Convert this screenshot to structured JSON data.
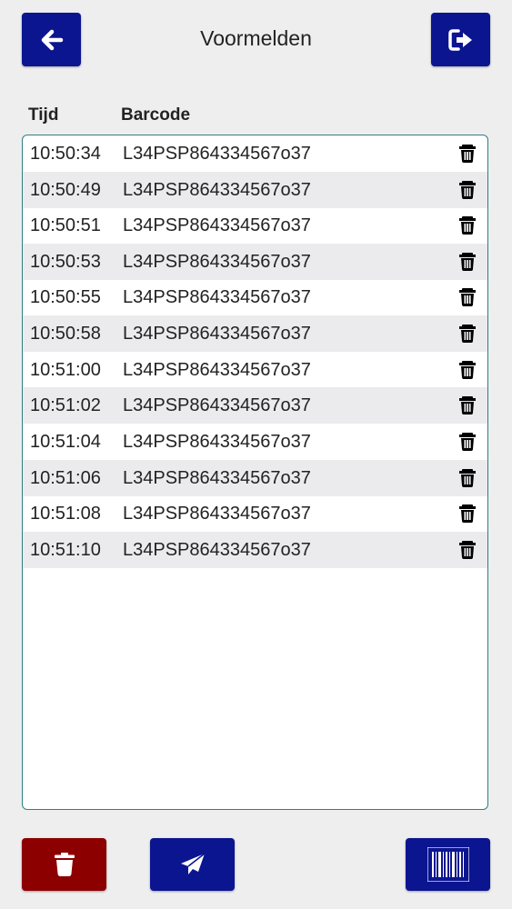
{
  "header": {
    "title": "Voormelden",
    "back_icon": "arrow-left-icon",
    "logout_icon": "sign-out-icon"
  },
  "columns": {
    "time": "Tijd",
    "barcode": "Barcode"
  },
  "rows": [
    {
      "time": "10:50:34",
      "barcode": "L34PSP864334567o37"
    },
    {
      "time": "10:50:49",
      "barcode": "L34PSP864334567o37"
    },
    {
      "time": "10:50:51",
      "barcode": "L34PSP864334567o37"
    },
    {
      "time": "10:50:53",
      "barcode": "L34PSP864334567o37"
    },
    {
      "time": "10:50:55",
      "barcode": "L34PSP864334567o37"
    },
    {
      "time": "10:50:58",
      "barcode": "L34PSP864334567o37"
    },
    {
      "time": "10:51:00",
      "barcode": "L34PSP864334567o37"
    },
    {
      "time": "10:51:02",
      "barcode": "L34PSP864334567o37"
    },
    {
      "time": "10:51:04",
      "barcode": "L34PSP864334567o37"
    },
    {
      "time": "10:51:06",
      "barcode": "L34PSP864334567o37"
    },
    {
      "time": "10:51:08",
      "barcode": "L34PSP864334567o37"
    },
    {
      "time": "10:51:10",
      "barcode": "L34PSP864334567o37"
    }
  ],
  "footer": {
    "delete_all_icon": "trash-icon",
    "send_icon": "paper-plane-icon",
    "scan_icon": "barcode-icon"
  },
  "colors": {
    "primary": "#0b1590",
    "danger": "#8c0000",
    "list_border": "#2f7f80",
    "row_alt": "#ebebee",
    "background": "#eeeeef"
  }
}
